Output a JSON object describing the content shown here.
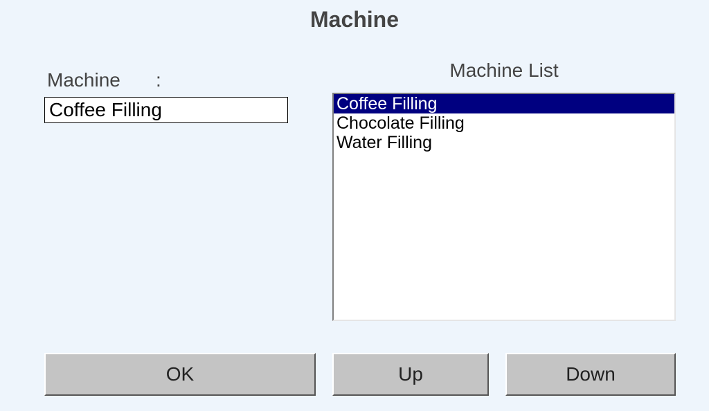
{
  "title": "Machine",
  "field": {
    "label": "Machine",
    "colon": ":",
    "value": "Coffee Filling"
  },
  "list": {
    "label": "Machine List",
    "items": [
      {
        "label": "Coffee Filling",
        "selected": true
      },
      {
        "label": "Chocolate Filling",
        "selected": false
      },
      {
        "label": "Water Filling",
        "selected": false
      }
    ]
  },
  "buttons": {
    "ok": "OK",
    "up": "Up",
    "down": "Down"
  }
}
